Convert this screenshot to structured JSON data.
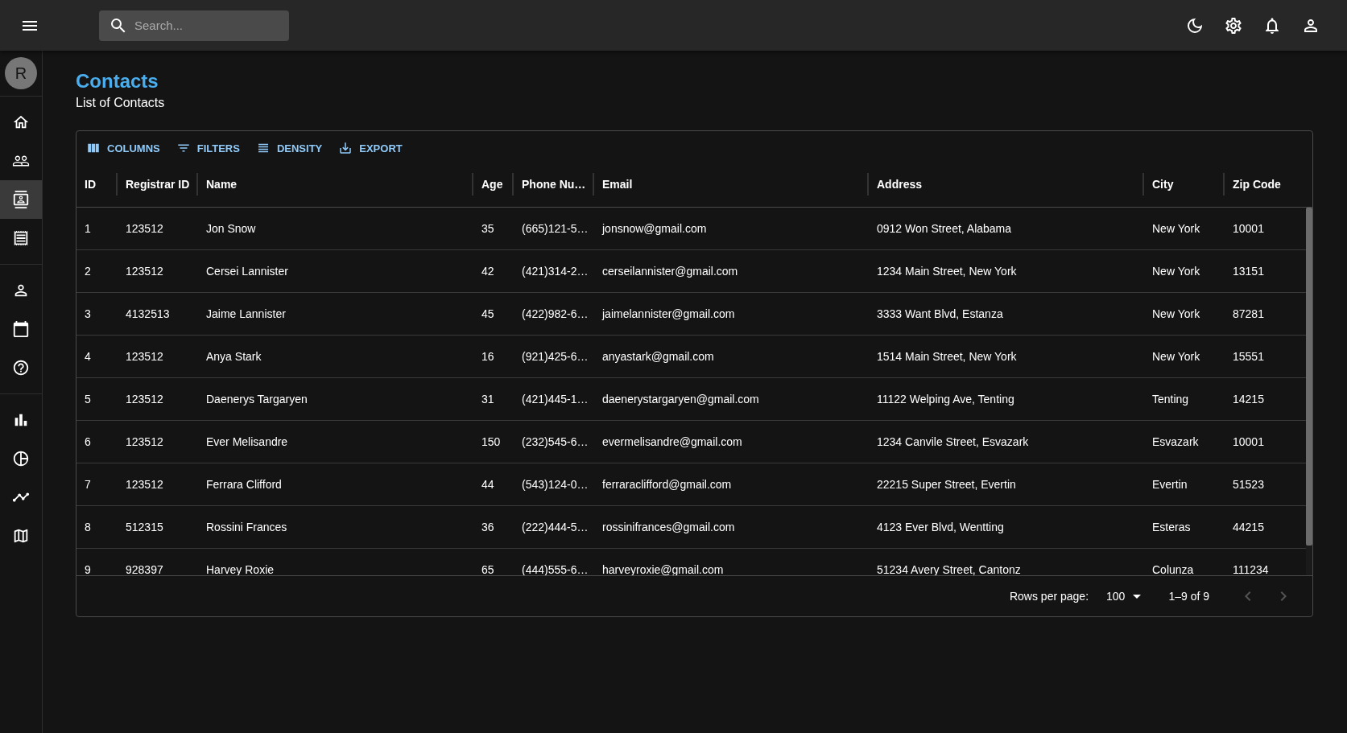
{
  "topbar": {
    "search": {
      "placeholder": "Search..."
    }
  },
  "sidebar": {
    "avatar": "R",
    "groups": [
      {
        "items": [
          {
            "selected": false
          },
          {
            "selected": false
          },
          {
            "selected": true
          },
          {
            "selected": false
          }
        ]
      },
      {
        "items": [
          {
            "selected": false
          },
          {
            "selected": false
          },
          {
            "selected": false
          }
        ]
      },
      {
        "items": [
          {
            "selected": false
          },
          {
            "selected": false
          },
          {
            "selected": false
          },
          {
            "selected": false
          }
        ]
      }
    ]
  },
  "page": {
    "title": "Contacts",
    "subtitle": "List of Contacts"
  },
  "toolbar": [
    "COLUMNS",
    "FILTERS",
    "DENSITY",
    "EXPORT"
  ],
  "table": {
    "columns": [
      "ID",
      "Registrar ID",
      "Name",
      "Age",
      "Phone Nu…",
      "Email",
      "Address",
      "City",
      "Zip Code"
    ],
    "rows": [
      [
        "1",
        "123512",
        "Jon Snow",
        "35",
        "(665)121-5…",
        "jonsnow@gmail.com",
        "0912 Won Street, Alabama",
        "New York",
        "10001"
      ],
      [
        "2",
        "123512",
        "Cersei Lannister",
        "42",
        "(421)314-2…",
        "cerseilannister@gmail.com",
        "1234 Main Street, New York",
        "New York",
        "13151"
      ],
      [
        "3",
        "4132513",
        "Jaime Lannister",
        "45",
        "(422)982-6…",
        "jaimelannister@gmail.com",
        "3333 Want Blvd, Estanza",
        "New York",
        "87281"
      ],
      [
        "4",
        "123512",
        "Anya Stark",
        "16",
        "(921)425-6…",
        "anyastark@gmail.com",
        "1514 Main Street, New York",
        "New York",
        "15551"
      ],
      [
        "5",
        "123512",
        "Daenerys Targaryen",
        "31",
        "(421)445-1…",
        "daenerystargaryen@gmail.com",
        "11122 Welping Ave, Tenting",
        "Tenting",
        "14215"
      ],
      [
        "6",
        "123512",
        "Ever Melisandre",
        "150",
        "(232)545-6…",
        "evermelisandre@gmail.com",
        "1234 Canvile Street, Esvazark",
        "Esvazark",
        "10001"
      ],
      [
        "7",
        "123512",
        "Ferrara Clifford",
        "44",
        "(543)124-0…",
        "ferraraclifford@gmail.com",
        "22215 Super Street, Evertin",
        "Evertin",
        "51523"
      ],
      [
        "8",
        "512315",
        "Rossini Frances",
        "36",
        "(222)444-5…",
        "rossinifrances@gmail.com",
        "4123 Ever Blvd, Wentting",
        "Esteras",
        "44215"
      ],
      [
        "9",
        "928397",
        "Harvey Roxie",
        "65",
        "(444)555-6…",
        "harveyroxie@gmail.com",
        "51234 Avery Street, Cantonz",
        "Colunza",
        "111234"
      ]
    ]
  },
  "pagination": {
    "rows_per_page_label": "Rows per page:",
    "rows_per_page": "100",
    "range": "1–9 of 9",
    "previous": {
      "disabled": true
    },
    "next": {
      "disabled": true
    }
  }
}
